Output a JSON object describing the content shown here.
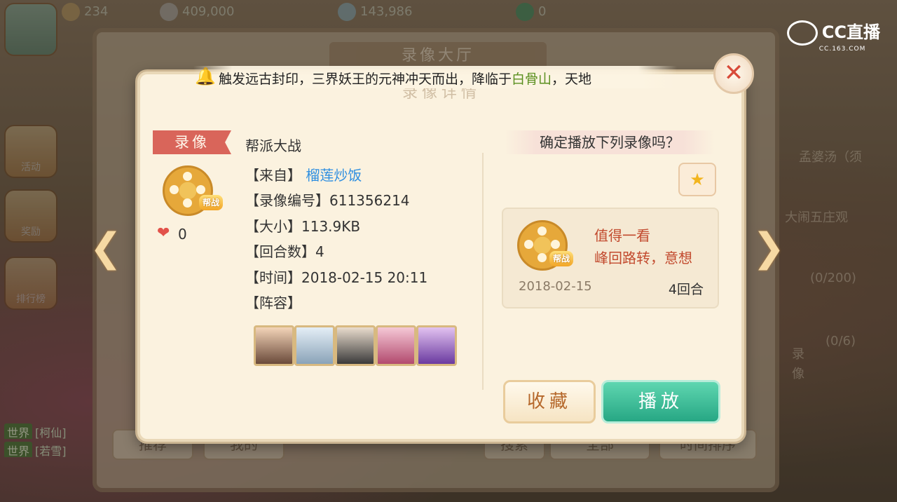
{
  "topbar": {
    "level": "234",
    "silver": "409,000",
    "gold": "143,986",
    "jade": "0"
  },
  "watermark": {
    "brand": "CC直播",
    "url": "CC.163.COM"
  },
  "background": {
    "hall_title": "录像大厅",
    "tabs": [
      "推荐",
      "我的",
      "搜索",
      "全部",
      "时间排序"
    ],
    "right_panel_lines": [
      "孟婆汤（须",
      "大闹五庄观",
      "(0/200)",
      "(0/6)",
      "录像"
    ],
    "left_menu": [
      "活动",
      "奖励",
      "排行榜"
    ],
    "chat": [
      {
        "channel": "世界",
        "text": "[柯仙]"
      },
      {
        "channel": "世界",
        "text": "[若雪]"
      }
    ]
  },
  "announcement": {
    "text_before": "触发远古封印，三界妖王的元神冲天而出，降临于",
    "highlight": "白骨山",
    "text_after": "，天地"
  },
  "dialog": {
    "title": "录像详情",
    "tag_label": "录像",
    "record_type": "帮派大战",
    "badge": "帮战",
    "likes": "0",
    "from_label": "【来自】",
    "from_value": "榴莲炒饭",
    "id_row": "【录像编号】611356214",
    "size_row": "【大小】113.9KB",
    "rounds_row": "【回合数】4",
    "time_row": "【时间】2018-02-15 20:11",
    "lineup_label": "【阵容】",
    "avatars": [
      "hero-1",
      "hero-2",
      "hero-3",
      "hero-4",
      "hero-5"
    ],
    "confirm_prompt": "确定播放下列录像吗？",
    "preview": {
      "title": "值得一看",
      "description": "峰回路转，意想",
      "date": "2018-02-15",
      "rounds": "4回合"
    },
    "favorite_button": "收藏",
    "play_button": "播放"
  },
  "colors": {
    "accent_green": "#27a784",
    "tag_red": "#d9655a",
    "link_blue": "#2f8fe0",
    "highlight_green": "#5a8f1f"
  }
}
